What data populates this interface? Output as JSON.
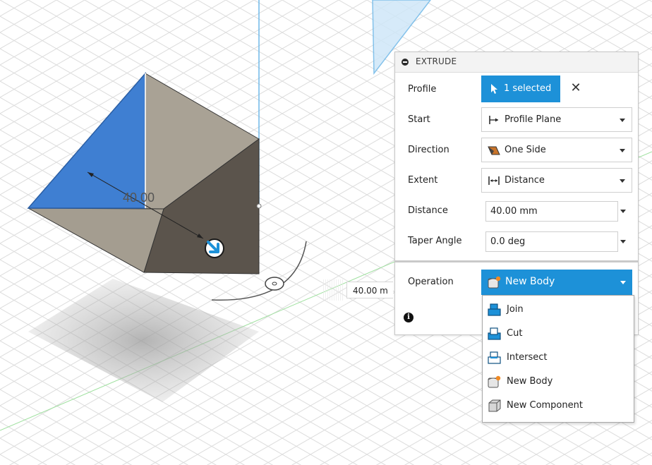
{
  "canvas": {
    "dimension_label": "40.00",
    "distance_input_value": "40.00 m"
  },
  "dialog": {
    "title": "EXTRUDE",
    "rows": {
      "profile": {
        "label": "Profile",
        "value": "1 selected",
        "clear_symbol": "✕"
      },
      "start": {
        "label": "Start",
        "value": "Profile Plane",
        "icon": "profile-plane-icon"
      },
      "direction": {
        "label": "Direction",
        "value": "One Side",
        "icon": "one-side-icon"
      },
      "extent": {
        "label": "Extent",
        "value": "Distance",
        "icon": "distance-icon"
      },
      "distance": {
        "label": "Distance",
        "value": "40.00 mm"
      },
      "taper_angle": {
        "label": "Taper Angle",
        "value": "0.0 deg"
      },
      "operation": {
        "label": "Operation",
        "value": "New Body",
        "icon": "new-body-icon"
      }
    },
    "info_symbol": "i"
  },
  "operation_menu": {
    "items": [
      {
        "label": "Join",
        "icon": "join-icon"
      },
      {
        "label": "Cut",
        "icon": "cut-icon"
      },
      {
        "label": "Intersect",
        "icon": "intersect-icon"
      },
      {
        "label": "New Body",
        "icon": "new-body-icon"
      },
      {
        "label": "New Component",
        "icon": "new-component-icon"
      }
    ]
  },
  "colors": {
    "accent": "#1d91d8",
    "selected_face": "#3f7fd2",
    "body_light": "#aaa397",
    "body_dark": "#5c554d",
    "grid": "#dcdcdc",
    "axis_green": "#8fdf8f"
  }
}
